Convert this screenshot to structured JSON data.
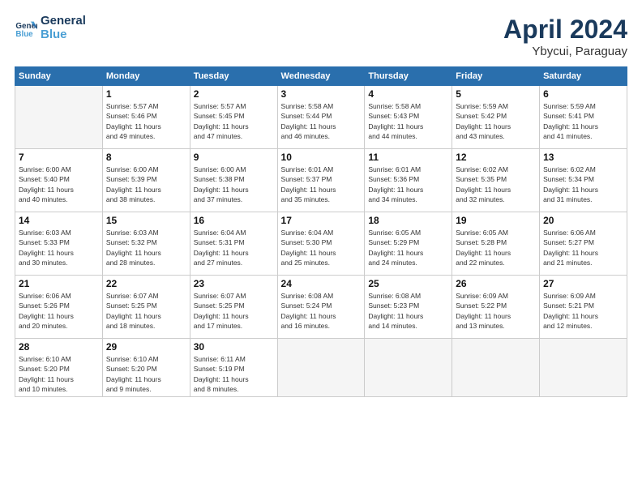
{
  "header": {
    "logo_line1": "General",
    "logo_line2": "Blue",
    "month_year": "April 2024",
    "location": "Ybycui, Paraguay"
  },
  "days_of_week": [
    "Sunday",
    "Monday",
    "Tuesday",
    "Wednesday",
    "Thursday",
    "Friday",
    "Saturday"
  ],
  "weeks": [
    [
      {
        "day": "",
        "info": ""
      },
      {
        "day": "1",
        "info": "Sunrise: 5:57 AM\nSunset: 5:46 PM\nDaylight: 11 hours\nand 49 minutes."
      },
      {
        "day": "2",
        "info": "Sunrise: 5:57 AM\nSunset: 5:45 PM\nDaylight: 11 hours\nand 47 minutes."
      },
      {
        "day": "3",
        "info": "Sunrise: 5:58 AM\nSunset: 5:44 PM\nDaylight: 11 hours\nand 46 minutes."
      },
      {
        "day": "4",
        "info": "Sunrise: 5:58 AM\nSunset: 5:43 PM\nDaylight: 11 hours\nand 44 minutes."
      },
      {
        "day": "5",
        "info": "Sunrise: 5:59 AM\nSunset: 5:42 PM\nDaylight: 11 hours\nand 43 minutes."
      },
      {
        "day": "6",
        "info": "Sunrise: 5:59 AM\nSunset: 5:41 PM\nDaylight: 11 hours\nand 41 minutes."
      }
    ],
    [
      {
        "day": "7",
        "info": "Sunrise: 6:00 AM\nSunset: 5:40 PM\nDaylight: 11 hours\nand 40 minutes."
      },
      {
        "day": "8",
        "info": "Sunrise: 6:00 AM\nSunset: 5:39 PM\nDaylight: 11 hours\nand 38 minutes."
      },
      {
        "day": "9",
        "info": "Sunrise: 6:00 AM\nSunset: 5:38 PM\nDaylight: 11 hours\nand 37 minutes."
      },
      {
        "day": "10",
        "info": "Sunrise: 6:01 AM\nSunset: 5:37 PM\nDaylight: 11 hours\nand 35 minutes."
      },
      {
        "day": "11",
        "info": "Sunrise: 6:01 AM\nSunset: 5:36 PM\nDaylight: 11 hours\nand 34 minutes."
      },
      {
        "day": "12",
        "info": "Sunrise: 6:02 AM\nSunset: 5:35 PM\nDaylight: 11 hours\nand 32 minutes."
      },
      {
        "day": "13",
        "info": "Sunrise: 6:02 AM\nSunset: 5:34 PM\nDaylight: 11 hours\nand 31 minutes."
      }
    ],
    [
      {
        "day": "14",
        "info": "Sunrise: 6:03 AM\nSunset: 5:33 PM\nDaylight: 11 hours\nand 30 minutes."
      },
      {
        "day": "15",
        "info": "Sunrise: 6:03 AM\nSunset: 5:32 PM\nDaylight: 11 hours\nand 28 minutes."
      },
      {
        "day": "16",
        "info": "Sunrise: 6:04 AM\nSunset: 5:31 PM\nDaylight: 11 hours\nand 27 minutes."
      },
      {
        "day": "17",
        "info": "Sunrise: 6:04 AM\nSunset: 5:30 PM\nDaylight: 11 hours\nand 25 minutes."
      },
      {
        "day": "18",
        "info": "Sunrise: 6:05 AM\nSunset: 5:29 PM\nDaylight: 11 hours\nand 24 minutes."
      },
      {
        "day": "19",
        "info": "Sunrise: 6:05 AM\nSunset: 5:28 PM\nDaylight: 11 hours\nand 22 minutes."
      },
      {
        "day": "20",
        "info": "Sunrise: 6:06 AM\nSunset: 5:27 PM\nDaylight: 11 hours\nand 21 minutes."
      }
    ],
    [
      {
        "day": "21",
        "info": "Sunrise: 6:06 AM\nSunset: 5:26 PM\nDaylight: 11 hours\nand 20 minutes."
      },
      {
        "day": "22",
        "info": "Sunrise: 6:07 AM\nSunset: 5:25 PM\nDaylight: 11 hours\nand 18 minutes."
      },
      {
        "day": "23",
        "info": "Sunrise: 6:07 AM\nSunset: 5:25 PM\nDaylight: 11 hours\nand 17 minutes."
      },
      {
        "day": "24",
        "info": "Sunrise: 6:08 AM\nSunset: 5:24 PM\nDaylight: 11 hours\nand 16 minutes."
      },
      {
        "day": "25",
        "info": "Sunrise: 6:08 AM\nSunset: 5:23 PM\nDaylight: 11 hours\nand 14 minutes."
      },
      {
        "day": "26",
        "info": "Sunrise: 6:09 AM\nSunset: 5:22 PM\nDaylight: 11 hours\nand 13 minutes."
      },
      {
        "day": "27",
        "info": "Sunrise: 6:09 AM\nSunset: 5:21 PM\nDaylight: 11 hours\nand 12 minutes."
      }
    ],
    [
      {
        "day": "28",
        "info": "Sunrise: 6:10 AM\nSunset: 5:20 PM\nDaylight: 11 hours\nand 10 minutes."
      },
      {
        "day": "29",
        "info": "Sunrise: 6:10 AM\nSunset: 5:20 PM\nDaylight: 11 hours\nand 9 minutes."
      },
      {
        "day": "30",
        "info": "Sunrise: 6:11 AM\nSunset: 5:19 PM\nDaylight: 11 hours\nand 8 minutes."
      },
      {
        "day": "",
        "info": ""
      },
      {
        "day": "",
        "info": ""
      },
      {
        "day": "",
        "info": ""
      },
      {
        "day": "",
        "info": ""
      }
    ]
  ]
}
